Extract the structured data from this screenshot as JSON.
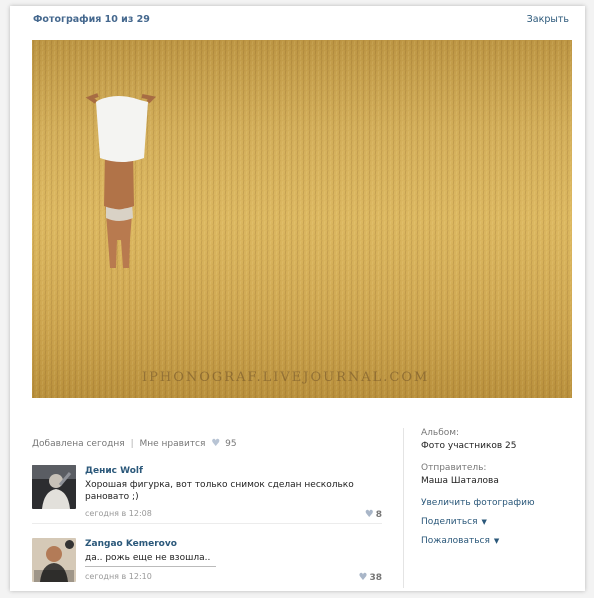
{
  "header": {
    "title": "Фотография 10 из 29",
    "close_label": "Закрыть"
  },
  "photo": {
    "watermark": "IPHONOGRAF.LIVEJOURNAL.COM"
  },
  "meta": {
    "added": "Добавлена сегодня",
    "separator": "|",
    "like_label": "Мне нравится",
    "like_icon": "heart-icon",
    "like_count": "95"
  },
  "comments": [
    {
      "author": "Денис Wolf",
      "text": "Хорошая фигурка, вот только снимок сделан несколько рановато ;)",
      "time": "сегодня в 12:08",
      "likes": "8"
    },
    {
      "author": "Zangao Kemerovo",
      "text": "да.. рожь еще не взошла..",
      "time": "сегодня в 12:10",
      "likes": "38"
    }
  ],
  "sidebar": {
    "album_label": "Альбом:",
    "album_value": "Фото участников 25",
    "sender_label": "Отправитель:",
    "sender_value": "Маша Шаталова",
    "enlarge_label": "Увеличить фотографию",
    "share_label": "Поделиться",
    "report_label": "Пожаловаться"
  },
  "colors": {
    "link": "#2b587a",
    "title": "#45688e",
    "field": "#d6b15a"
  }
}
